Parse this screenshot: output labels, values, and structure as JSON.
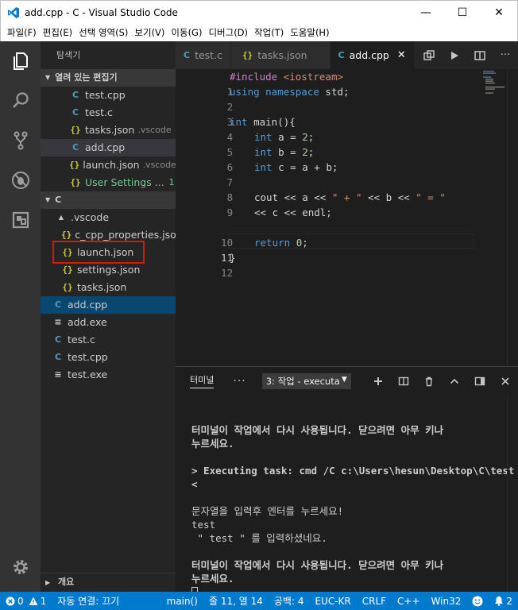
{
  "window": {
    "title": "add.cpp - C - Visual Studio Code",
    "minimize": "—",
    "maximize": "☐",
    "close": "✕"
  },
  "menu": [
    "파일(F)",
    "편집(E)",
    "선택 영역(S)",
    "보기(V)",
    "이동(G)",
    "디버그(D)",
    "작업(T)",
    "도움말(H)"
  ],
  "sidebar": {
    "title": "탐색기",
    "open_editors_header": "열려 있는 편집기",
    "open_editors": [
      {
        "icon": "C",
        "label": "test.cpp",
        "desc": ""
      },
      {
        "icon": "C",
        "label": "test.c",
        "desc": ""
      },
      {
        "icon": "{}",
        "label": "tasks.json",
        "desc": ".vscode"
      },
      {
        "icon": "C",
        "label": "add.cpp",
        "desc": ""
      },
      {
        "icon": "{}",
        "label": "launch.json",
        "desc": ".vscode"
      },
      {
        "icon": "{}",
        "label": "User Settings ...",
        "desc": "1"
      }
    ],
    "folder_header": "C",
    "tree": [
      {
        "icon": "▲",
        "label": ".vscode"
      },
      {
        "icon": "{}",
        "label": "c_cpp_properties.json"
      },
      {
        "icon": "{}",
        "label": "launch.json"
      },
      {
        "icon": "{}",
        "label": "settings.json"
      },
      {
        "icon": "{}",
        "label": "tasks.json"
      },
      {
        "icon": "C",
        "label": "add.cpp"
      },
      {
        "icon": "≡",
        "label": "add.exe"
      },
      {
        "icon": "C",
        "label": "test.c"
      },
      {
        "icon": "C",
        "label": "test.cpp"
      },
      {
        "icon": "≡",
        "label": "test.exe"
      }
    ],
    "outline_header": "개요"
  },
  "tabs": [
    {
      "icon": "C",
      "label": "test.c"
    },
    {
      "icon": "{}",
      "label": "tasks.json"
    },
    {
      "icon": "C",
      "label": "add.cpp",
      "close": "✕"
    }
  ],
  "editor": {
    "line_numbers": [
      "1",
      "2",
      "3",
      "4",
      "5",
      "6",
      "7",
      "8",
      "9",
      "",
      "10",
      "11",
      "12"
    ],
    "lines": {
      "l1a": "#include ",
      "l1b": "<iostream>",
      "l2a": "using ",
      "l2b": "namespace ",
      "l2c": "std;",
      "l4a": "int ",
      "l4b": "main(){",
      "l5a": "int ",
      "l5b": "a = ",
      "l5c": "2",
      "l5d": ";",
      "l6a": "int ",
      "l6b": "b = ",
      "l6c": "2",
      "l6d": ";",
      "l7a": "int ",
      "l7b": "c = a + b;",
      "l9a": "cout << a << ",
      "l9b": "\" + \"",
      "l9c": " << b << ",
      "l9d": "\" = \"",
      "l9e": "<< c << endl;",
      "l11a": "return ",
      "l11b": "0",
      "l11c": ";",
      "l12a": "}"
    }
  },
  "panel": {
    "tab": "터미널",
    "more": "···",
    "terminal_select": "3: 작업 - executa",
    "select_arrow": "▼",
    "terminal_lines": [
      "터미널이 작업에서 다시 사용됩니다. 닫으려면 아무 키나",
      "누르세요.",
      "",
      "> Executing task: cmd /C c:\\Users\\hesun\\Desktop\\C\\test",
      "<",
      "",
      "문자열을 입력후 엔터를 누르세요!",
      "test",
      " \" test \" 를 입력하셨네요.",
      "",
      "터미널이 작업에서 다시 사용됩니다. 닫으려면 아무 키나",
      "누르세요."
    ]
  },
  "statusbar": {
    "errors": "0",
    "warnings": "1",
    "auto_connect": "자동 연결: 끄기",
    "scope": "main()",
    "position": "줄 11, 열 14",
    "spaces": "공백: 4",
    "encoding": "EUC-KR",
    "eol": "CRLF",
    "language": "C++",
    "platform": "Win32",
    "notifications": "2"
  },
  "colors": {
    "activity_bar": "#333333",
    "sidebar": "#252526",
    "editor": "#1e1e1e",
    "statusbar": "#007acc",
    "selection": "#094771",
    "highlight_box": "#e51400"
  }
}
